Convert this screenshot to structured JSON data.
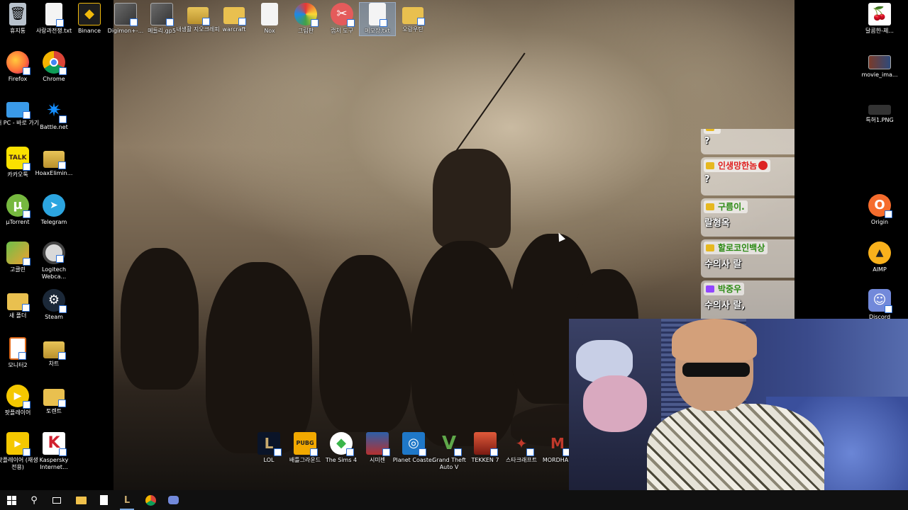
{
  "desktop_left": [
    {
      "label": "휴지통",
      "icon": "recycle-bin-icon"
    },
    {
      "label": "사랑과전쟁.txt",
      "icon": "text-file-icon"
    },
    {
      "label": "Binance",
      "icon": "binance-icon"
    },
    {
      "label": "Firefox",
      "icon": "firefox-icon"
    },
    {
      "label": "Chrome",
      "icon": "chrome-icon"
    },
    {
      "label": "내 PC - 바로 가기",
      "icon": "computer-icon"
    },
    {
      "label": "Battle.net",
      "icon": "battlenet-icon"
    },
    {
      "label": "카카오톡",
      "icon": "kakaotalk-icon"
    },
    {
      "label": "HoaxElimin...",
      "icon": "folder-zip-icon"
    },
    {
      "label": "µTorrent",
      "icon": "utorrent-icon"
    },
    {
      "label": "Telegram",
      "icon": "telegram-icon"
    },
    {
      "label": "고클린",
      "icon": "goclean-icon"
    },
    {
      "label": "Logitech Webca...",
      "icon": "webcam-icon"
    },
    {
      "label": "새 폴더",
      "icon": "folder-icon"
    },
    {
      "label": "Steam",
      "icon": "steam-icon"
    },
    {
      "label": "모니터2",
      "icon": "monitor-file-icon"
    },
    {
      "label": "차트",
      "icon": "folder-zip-icon"
    },
    {
      "label": "팟플레이어",
      "icon": "potplayer-icon"
    },
    {
      "label": "토렌트",
      "icon": "folder-zip-icon"
    },
    {
      "label": "팟플레이어 (재생 전용)",
      "icon": "potplayer-icon"
    },
    {
      "label": "Kaspersky Internet...",
      "icon": "kaspersky-icon"
    }
  ],
  "desktop_top": [
    {
      "label": "Digimon+-...",
      "icon": "video-thumbnail-icon"
    },
    {
      "label": "메들리.gp5",
      "icon": "gp5-file-icon"
    },
    {
      "label": "내생활 지오크레피",
      "icon": "folder-zip-icon"
    },
    {
      "label": "warcraft",
      "icon": "folder-icon"
    },
    {
      "label": "Nox",
      "icon": "file-icon"
    },
    {
      "label": "그림판",
      "icon": "paint-icon"
    },
    {
      "label": "캡처 도구",
      "icon": "snipping-tool-icon"
    },
    {
      "label": "메모장.txt",
      "icon": "text-file-icon"
    },
    {
      "label": "오랑우탄",
      "icon": "folder-icon"
    }
  ],
  "desktop_right": [
    {
      "label": "달콤한-체...",
      "icon": "cherry-icon"
    },
    {
      "label": "movie_ima...",
      "icon": "image-thumbnail-icon"
    },
    {
      "label": "특허1.PNG",
      "icon": "png-thumbnail-icon"
    },
    {
      "label": "Origin",
      "icon": "origin-icon"
    },
    {
      "label": "AIMP",
      "icon": "aimp-icon"
    },
    {
      "label": "Discord",
      "icon": "discord-icon"
    }
  ],
  "desktop_games": [
    {
      "label": "LOL",
      "icon": "league-of-legends-icon"
    },
    {
      "label": "배틀그라운드",
      "icon": "pubg-icon"
    },
    {
      "label": "The Sims 4",
      "icon": "sims-icon"
    },
    {
      "label": "시미젠",
      "icon": "game-cover-icon"
    },
    {
      "label": "Planet Coaster",
      "icon": "planet-coaster-icon"
    },
    {
      "label": "Grand Theft Auto V",
      "icon": "gta-v-icon"
    },
    {
      "label": "TEKKEN 7",
      "icon": "tekken-icon"
    },
    {
      "label": "스타크래프트",
      "icon": "starcraft-icon"
    },
    {
      "label": "MORDHAU",
      "icon": "mordhau-icon"
    }
  ],
  "chat": [
    {
      "name": "",
      "text": "?",
      "color": "#2a8a12",
      "badge": "yellow"
    },
    {
      "name": "인생망한놈",
      "text": "?",
      "color": "#e01f1f",
      "badge": "yellow"
    },
    {
      "name": "구름이.",
      "text": "랄형옥",
      "color": "#2a8a12",
      "badge": "yellow"
    },
    {
      "name": "할로코인백상",
      "text": "수의사 랄",
      "color": "#2a8a12",
      "badge": "yellow"
    },
    {
      "name": "박중우",
      "text": "수의사 랄,",
      "color": "#2a8a12",
      "badge": "purple"
    }
  ],
  "taskbar": [
    {
      "icon": "windows-start-icon"
    },
    {
      "icon": "search-icon"
    },
    {
      "icon": "task-view-icon"
    },
    {
      "icon": "file-explorer-icon"
    },
    {
      "icon": "calculator-icon"
    },
    {
      "icon": "league-client-icon"
    },
    {
      "icon": "chrome-icon"
    },
    {
      "icon": "discord-icon"
    }
  ]
}
